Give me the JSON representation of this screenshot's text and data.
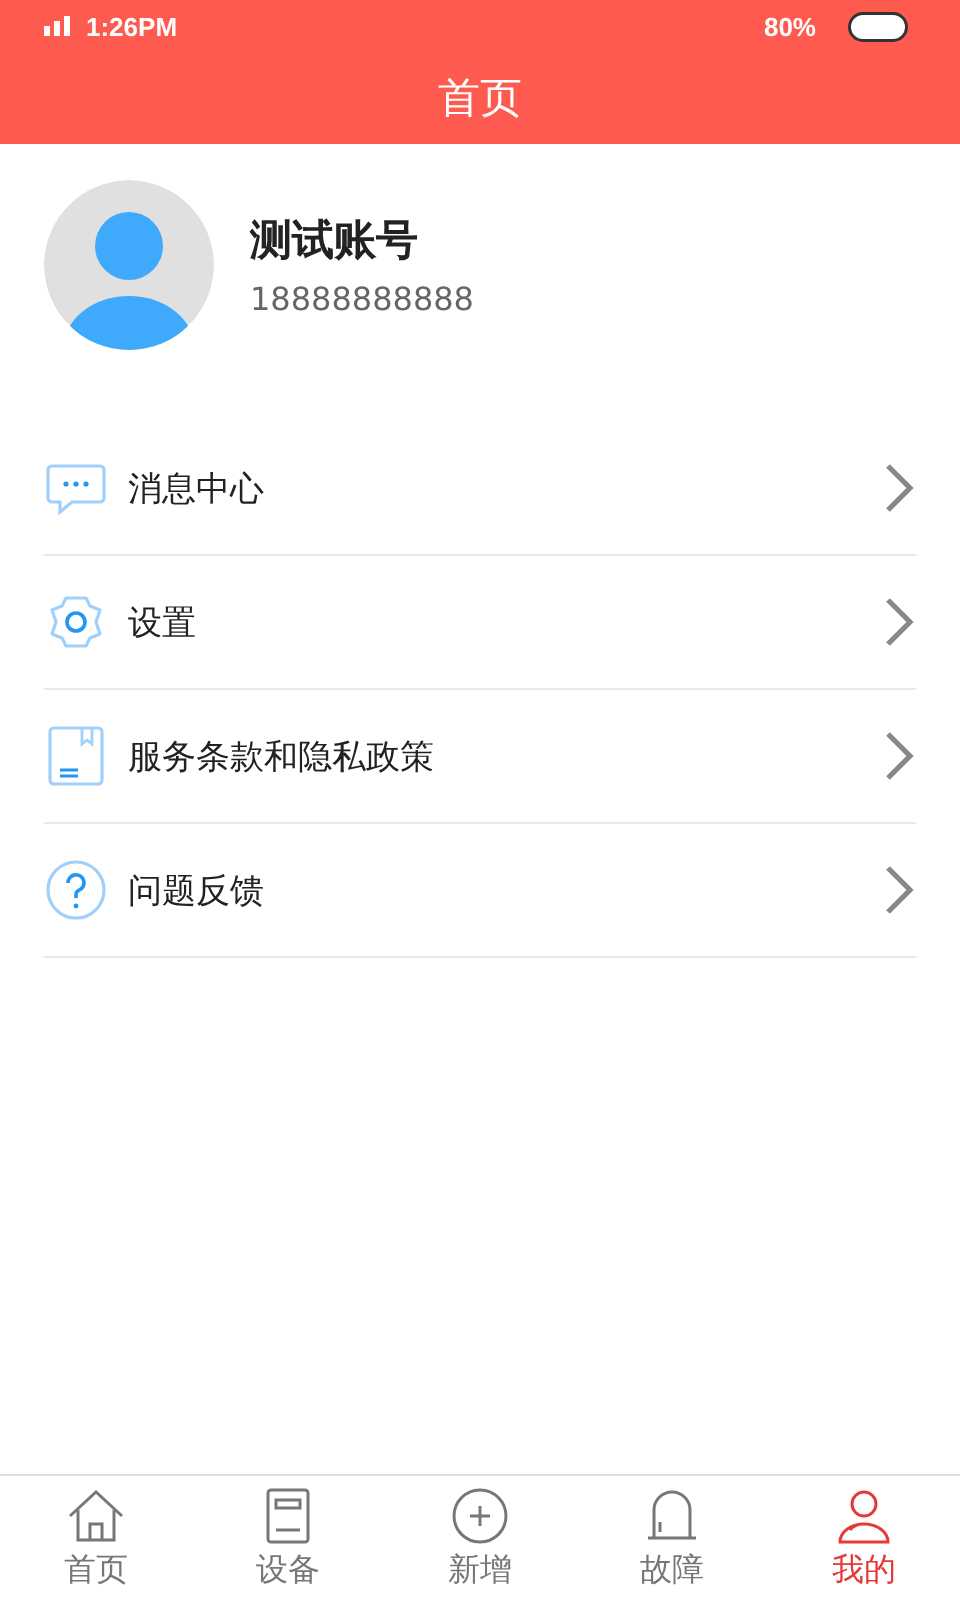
{
  "status_bar": {
    "time": "1:26PM",
    "battery": "80%"
  },
  "header": {
    "title": "首页"
  },
  "profile": {
    "name": "测试账号",
    "phone": "18888888888"
  },
  "menu": [
    {
      "kind": "message",
      "label": "消息中心"
    },
    {
      "kind": "settings",
      "label": "设置"
    },
    {
      "kind": "document",
      "label": "服务条款和隐私政策"
    },
    {
      "kind": "help",
      "label": "问题反馈"
    }
  ],
  "tabs": [
    {
      "kind": "home",
      "label": "首页",
      "selected": false
    },
    {
      "kind": "device",
      "label": "设备",
      "selected": false
    },
    {
      "kind": "add",
      "label": "新增",
      "selected": false
    },
    {
      "kind": "alarm",
      "label": "故障",
      "selected": false
    },
    {
      "kind": "user",
      "label": "我的",
      "selected": true
    }
  ]
}
